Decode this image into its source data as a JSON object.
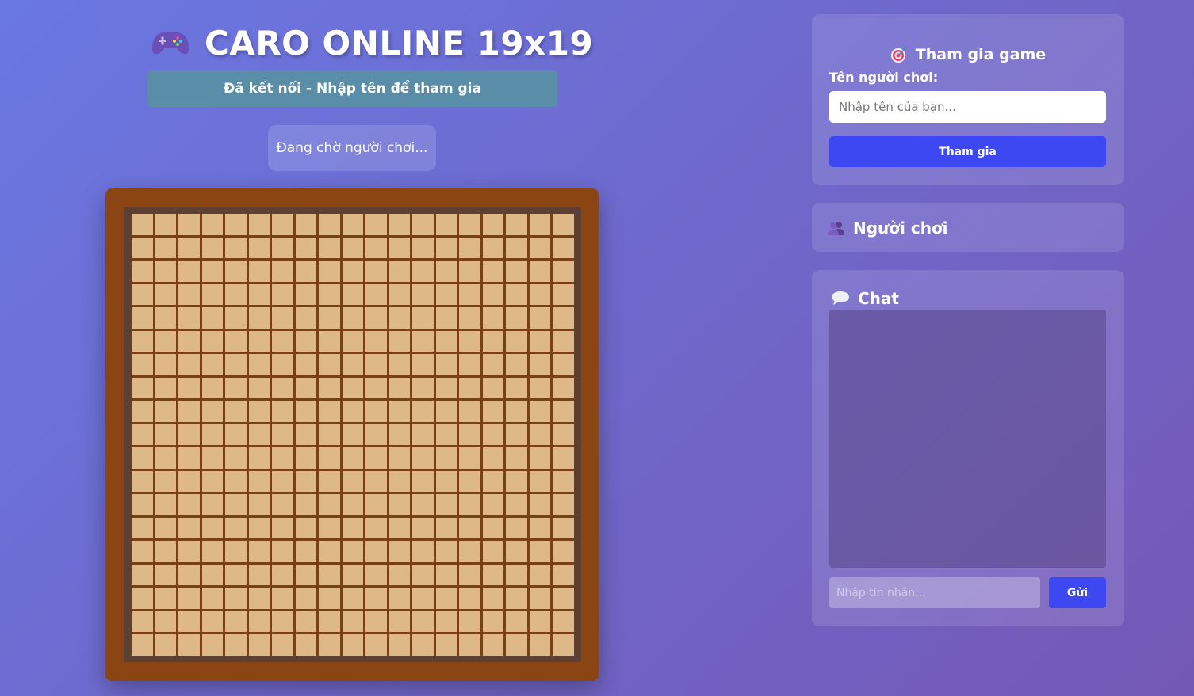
{
  "header": {
    "title": "CARO ONLINE 19x19",
    "icon": "gamepad-icon"
  },
  "status": {
    "connection": "Đã kết nối - Nhập tên để tham gia",
    "waiting": "Đang chờ người chơi..."
  },
  "board": {
    "rows": 19,
    "cols": 19,
    "colors": {
      "frame": "#8b4513",
      "cell": "#deb887"
    }
  },
  "join": {
    "heading": "Tham gia game",
    "icon": "target-icon",
    "name_label": "Tên người chơi:",
    "name_placeholder": "Nhập tên của bạn...",
    "button": "Tham gia"
  },
  "players": {
    "heading": "Người chơi",
    "icon": "users-icon"
  },
  "chat": {
    "heading": "Chat",
    "icon": "speech-bubble-icon",
    "input_placeholder": "Nhập tin nhắn...",
    "send_button": "Gửi"
  },
  "colors": {
    "accent": "#3d48f3",
    "status_bar": "#5a8ea8"
  }
}
